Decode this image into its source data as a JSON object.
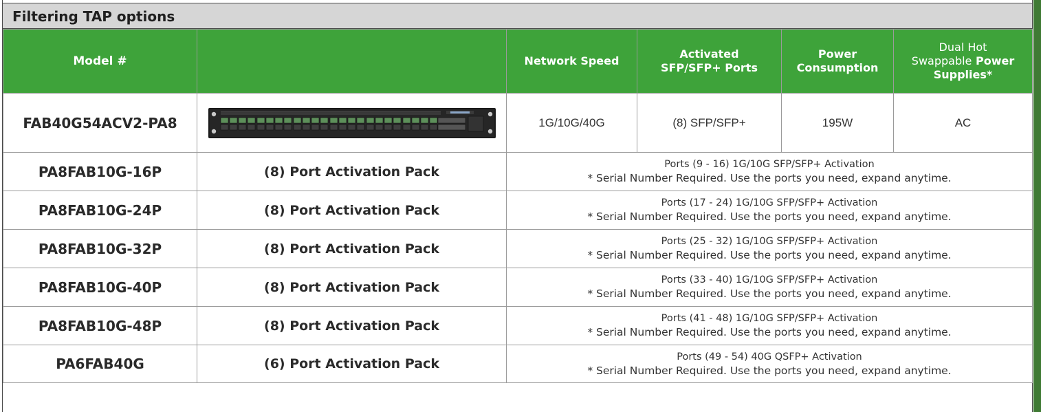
{
  "title": "Filtering TAP options",
  "headers": {
    "model": "Model #",
    "image": "",
    "network_speed": "Network Speed",
    "activated_ports_line1": "Activated",
    "activated_ports_line2": "SFP/SFP+ Ports",
    "power_consumption_line1": "Power",
    "power_consumption_line2": "Consumption",
    "power_supplies_line1": "Dual Hot",
    "power_supplies_line2a": "Swappable",
    "power_supplies_line2b": "Power",
    "power_supplies_line3": "Supplies*"
  },
  "main_product": {
    "model": "FAB40G54ACV2-PA8",
    "image_icon": "network-switch-device",
    "network_speed": "1G/10G/40G",
    "activated_ports": "(8) SFP/SFP+",
    "power_consumption": "195W",
    "power_supplies": "AC"
  },
  "activation_packs": [
    {
      "model": "PA8FAB10G-16P",
      "name": "(8) Port Activation Pack",
      "ports": "Ports (9 - 16) 1G/10G SFP/SFP+ Activation",
      "note": "* Serial Number Required. Use the ports you need, expand anytime."
    },
    {
      "model": "PA8FAB10G-24P",
      "name": "(8) Port Activation Pack",
      "ports": "Ports (17 - 24) 1G/10G SFP/SFP+ Activation",
      "note": "* Serial Number Required. Use the ports you need, expand anytime."
    },
    {
      "model": "PA8FAB10G-32P",
      "name": "(8) Port Activation Pack",
      "ports": "Ports (25 - 32) 1G/10G SFP/SFP+ Activation",
      "note": "* Serial Number Required. Use the ports you need, expand anytime."
    },
    {
      "model": "PA8FAB10G-40P",
      "name": "(8) Port Activation Pack",
      "ports": "Ports (33 - 40) 1G/10G SFP/SFP+ Activation",
      "note": "* Serial Number Required. Use the ports you need, expand anytime."
    },
    {
      "model": "PA8FAB10G-48P",
      "name": "(8) Port Activation Pack",
      "ports": "Ports (41 - 48) 1G/10G SFP/SFP+ Activation",
      "note": "* Serial Number Required. Use the ports you need, expand anytime."
    },
    {
      "model": "PA6FAB40G",
      "name": "(6) Port Activation Pack",
      "ports": "Ports (49 - 54) 40G QSFP+ Activation",
      "note": "* Serial Number Required. Use the ports you need, expand anytime."
    }
  ],
  "colors": {
    "header_green": "#3ea33a",
    "title_gray": "#d6d6d6",
    "border_gray": "#9a9a9a"
  }
}
